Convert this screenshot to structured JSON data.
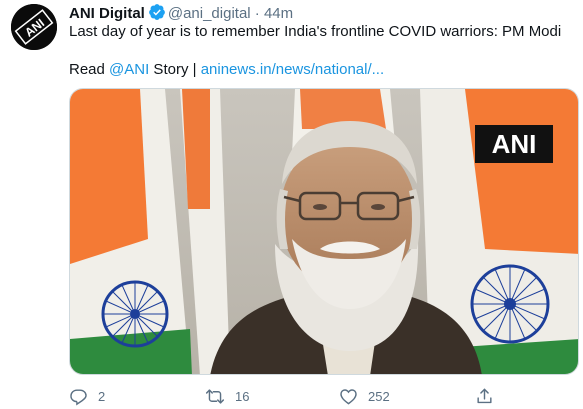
{
  "tweet": {
    "author_name": "ANI Digital",
    "author_handle": "@ani_digital",
    "separator": "·",
    "time": "44m",
    "avatar_text": "ANI",
    "text_line1": "Last day of year is to remember India's frontline COVID warriors: PM Modi",
    "read_prefix": "Read ",
    "mention": "@ANI",
    "story_text": " Story | ",
    "link": "aninews.in/news/national/..."
  },
  "media": {
    "watermark": "ANI",
    "alt": "PM Modi addressing via video with Indian flags in background"
  },
  "actions": {
    "reply_count": "2",
    "retweet_count": "16",
    "like_count": "252"
  },
  "colors": {
    "link": "#1b95e0",
    "secondary": "#5b7083",
    "verified": "#1da1f2",
    "flag_saffron": "#f47a35",
    "flag_green": "#2e8b3e",
    "chakra_blue": "#1d3f9a"
  }
}
